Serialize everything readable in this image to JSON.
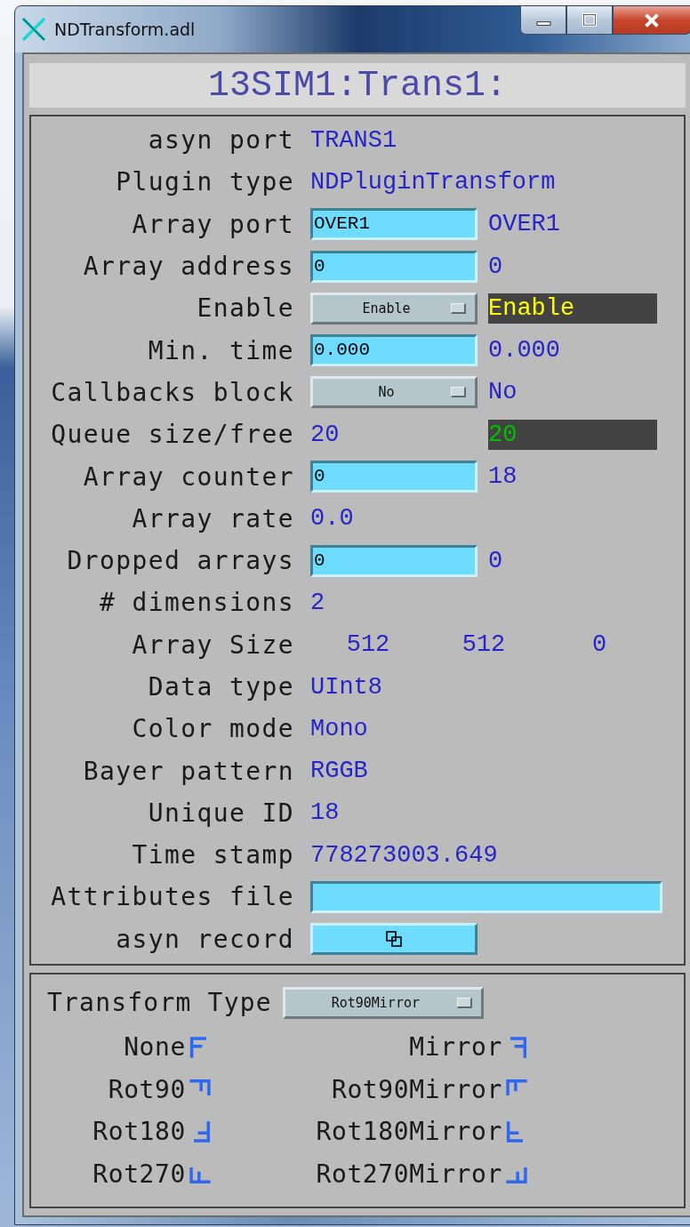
{
  "window": {
    "title": "NDTransform.adl"
  },
  "header": "13SIM1:Trans1:",
  "rows": [
    {
      "kind": "readback",
      "label": "asyn port",
      "values": [
        {
          "text": "TRANS1",
          "kind": "plain"
        }
      ]
    },
    {
      "kind": "readback",
      "label": "Plugin type",
      "values": [
        {
          "text": "NDPluginTransform",
          "kind": "plain"
        }
      ]
    },
    {
      "kind": "input",
      "label": "Array port",
      "input": "OVER1",
      "values": [
        {
          "text": "OVER1",
          "kind": "plain"
        }
      ]
    },
    {
      "kind": "input",
      "label": "Array address",
      "input": "0",
      "values": [
        {
          "text": "0",
          "kind": "plain"
        }
      ]
    },
    {
      "kind": "menu",
      "label": "Enable",
      "menu": "Enable",
      "values": [
        {
          "text": "Enable",
          "kind": "yellow"
        }
      ]
    },
    {
      "kind": "input",
      "label": "Min. time",
      "input": "0.000",
      "values": [
        {
          "text": "0.000",
          "kind": "plain"
        }
      ]
    },
    {
      "kind": "menu",
      "label": "Callbacks block",
      "menu": "No",
      "values": [
        {
          "text": "No",
          "kind": "plain"
        }
      ]
    },
    {
      "kind": "readback",
      "label": "Queue size/free",
      "values": [
        {
          "text": "20",
          "kind": "plain"
        },
        {
          "text": "20",
          "kind": "green"
        }
      ]
    },
    {
      "kind": "input",
      "label": "Array counter",
      "input": "0",
      "values": [
        {
          "text": "18",
          "kind": "plain"
        }
      ]
    },
    {
      "kind": "readback",
      "label": "Array rate",
      "values": [
        {
          "text": "0.0",
          "kind": "plain"
        }
      ]
    },
    {
      "kind": "input",
      "label": "Dropped arrays",
      "input": "0",
      "values": [
        {
          "text": "0",
          "kind": "plain"
        }
      ]
    },
    {
      "kind": "readback",
      "label": "# dimensions",
      "values": [
        {
          "text": "2",
          "kind": "plain"
        }
      ]
    },
    {
      "kind": "spread",
      "label": "Array Size",
      "values": [
        {
          "text": "512",
          "kind": "plain"
        },
        {
          "text": "512",
          "kind": "plain"
        },
        {
          "text": "0",
          "kind": "plain"
        }
      ]
    },
    {
      "kind": "readback",
      "label": "Data type",
      "values": [
        {
          "text": "UInt8",
          "kind": "plain"
        }
      ]
    },
    {
      "kind": "readback",
      "label": "Color mode",
      "values": [
        {
          "text": "Mono",
          "kind": "plain"
        }
      ]
    },
    {
      "kind": "readback",
      "label": "Bayer pattern",
      "values": [
        {
          "text": "RGGB",
          "kind": "plain"
        }
      ]
    },
    {
      "kind": "readback",
      "label": "Unique ID",
      "values": [
        {
          "text": "18",
          "kind": "plain"
        }
      ]
    },
    {
      "kind": "readback",
      "label": "Time stamp",
      "values": [
        {
          "text": "778273003.649",
          "kind": "plain"
        }
      ]
    },
    {
      "kind": "wide-input",
      "label": "Attributes file"
    },
    {
      "kind": "related-display",
      "label": "asyn record"
    }
  ],
  "transform": {
    "label": "Transform Type",
    "menu": "Rot90Mirror",
    "legend": [
      {
        "name": "None",
        "kind": "none"
      },
      {
        "name": "Mirror",
        "kind": "mirror"
      },
      {
        "name": "Rot90",
        "kind": "rot90"
      },
      {
        "name": "Rot90Mirror",
        "kind": "rot90mirror"
      },
      {
        "name": "Rot180",
        "kind": "rot180"
      },
      {
        "name": "Rot180Mirror",
        "kind": "rot180mirror"
      },
      {
        "name": "Rot270",
        "kind": "rot270"
      },
      {
        "name": "Rot270Mirror",
        "kind": "rot270mirror"
      }
    ]
  }
}
